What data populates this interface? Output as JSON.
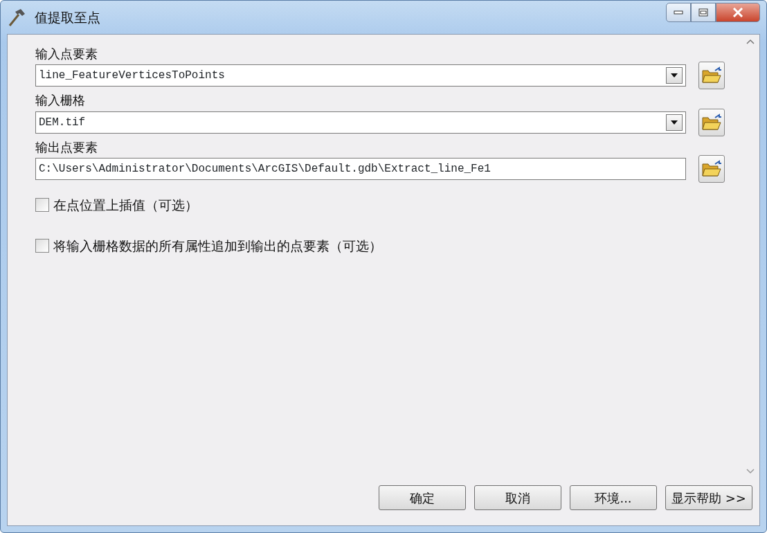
{
  "window": {
    "title": "值提取至点"
  },
  "parameters": [
    {
      "kind": "dropdown",
      "label": "输入点要素",
      "value": "line_FeatureVerticesToPoints"
    },
    {
      "kind": "dropdown",
      "label": "输入栅格",
      "value": "DEM.tif"
    },
    {
      "kind": "text",
      "label": "输出点要素",
      "value": "C:\\Users\\Administrator\\Documents\\ArcGIS\\Default.gdb\\Extract_line_Fe1"
    }
  ],
  "options": [
    {
      "label": "在点位置上插值（可选）",
      "checked": false
    },
    {
      "label": "将输入栅格数据的所有属性追加到输出的点要素（可选）",
      "checked": false
    }
  ],
  "buttons": [
    "确定",
    "取消",
    "环境...",
    "显示帮助 >>"
  ]
}
